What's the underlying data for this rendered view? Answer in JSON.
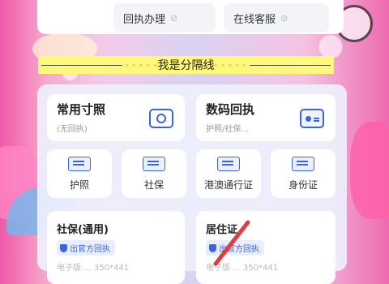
{
  "top_buttons": [
    {
      "label": "回执办理",
      "suffix": "⊘"
    },
    {
      "label": "在线客服",
      "suffix": "⊘"
    }
  ],
  "divider": {
    "text": "我是分隔线"
  },
  "big_cards": [
    {
      "title": "常用寸照",
      "subtitle": "(无回执)",
      "icon": "camera-icon"
    },
    {
      "title": "数码回执",
      "subtitle": "护照/社保...",
      "icon": "id-card-icon"
    }
  ],
  "small_cards": [
    {
      "label": "护照",
      "icon": "passport-icon"
    },
    {
      "label": "社保",
      "icon": "social-security-icon"
    },
    {
      "label": "港澳通行证",
      "icon": "hk-macau-permit-icon"
    },
    {
      "label": "身份证",
      "icon": "id-card-icon"
    }
  ],
  "bottom_cards": [
    {
      "title": "社保(通用)",
      "badge": "出官方回执",
      "extra": "电子版 ...  350*441"
    },
    {
      "title": "居住证",
      "badge": "出官方回执",
      "extra": "电子版 ...  350*441"
    }
  ],
  "colors": {
    "accent": "#3a66d9",
    "divider_bg": "#fff97a"
  }
}
